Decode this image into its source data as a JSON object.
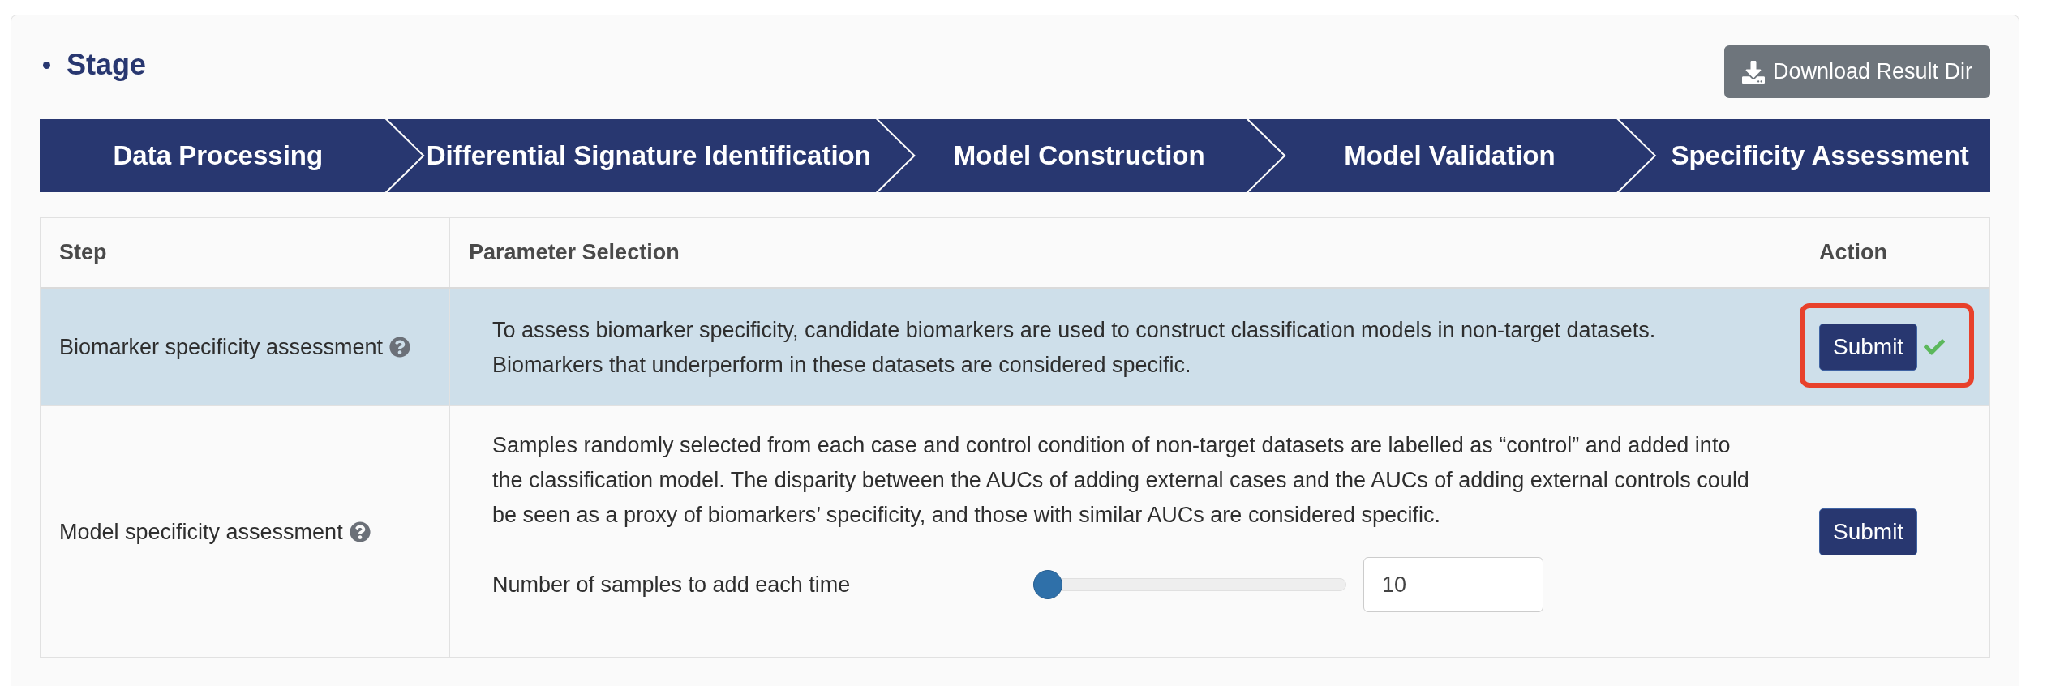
{
  "section": {
    "title": "Stage"
  },
  "download_button": {
    "label": "Download Result Dir"
  },
  "stages": [
    {
      "label": "Data Processing"
    },
    {
      "label": "Differential Signature Identification"
    },
    {
      "label": "Model Construction"
    },
    {
      "label": "Model Validation"
    },
    {
      "label": "Specificity Assessment"
    }
  ],
  "table": {
    "columns": [
      "Step",
      "Parameter Selection",
      "Action"
    ],
    "rows": [
      {
        "step": "Biomarker specificity assessment",
        "selected": true,
        "description": "To assess biomarker specificity, candidate biomarkers are used to construct classification models in non-target datasets. Biomarkers that underperform in these datasets are considered specific.",
        "action": {
          "label": "Submit",
          "done": true,
          "highlighted": true
        }
      },
      {
        "step": "Model specificity assessment",
        "selected": false,
        "description": "Samples randomly selected from each case and control condition of non-target datasets are labelled as “control” and added into the classification model. The disparity between the AUCs of adding external cases and the AUCs of adding external controls could be seen as a proxy of biomarkers’ specificity, and those with similar AUCs are considered specific.",
        "params": [
          {
            "kind": "slider",
            "label": "Number of samples to add each time",
            "level": 0,
            "value": "10"
          }
        ],
        "action": {
          "label": "Submit",
          "done": false,
          "highlighted": false
        }
      }
    ]
  }
}
